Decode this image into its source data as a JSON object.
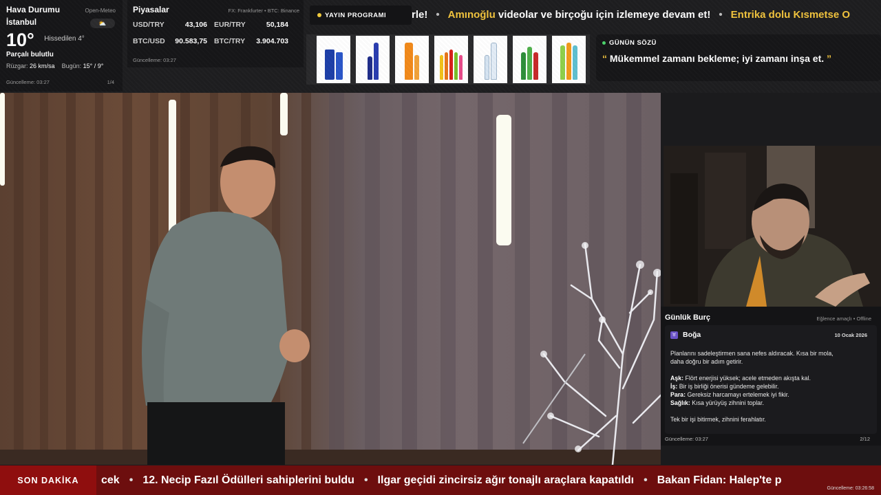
{
  "weather": {
    "title": "Hava Durumu",
    "source": "Open-Meteo",
    "city": "İstanbul",
    "temperature": "10°",
    "feels_like": "Hissedilen 4°",
    "condition": "Parçalı bulutlu",
    "wind_label": "Rüzgar:",
    "wind_value": "26 km/sa",
    "today_label": "Bugün:",
    "today_value": "15° / 9°",
    "updated": "Güncelleme: 03:27",
    "page": "1/4",
    "icon": "partly-cloudy-icon"
  },
  "markets": {
    "title": "Piyasalar",
    "source": "FX: Frankfurter • BTC: Binance",
    "rates": [
      {
        "pair": "USD/TRY",
        "value": "43,106"
      },
      {
        "pair": "EUR/TRY",
        "value": "50,184"
      },
      {
        "pair": "BTC/USD",
        "value": "90.583,75"
      },
      {
        "pair": "BTC/TRY",
        "value": "3.904.703"
      }
    ],
    "updated": "Güncelleme: 03:27"
  },
  "schedule": {
    "label": "YAYIN PROGRAMI"
  },
  "top_ticker": {
    "part1": "rle!",
    "part2_highlight": "Amınoğlu",
    "part2": " videolar ve birçoğu için izlemeye devam et!",
    "part3_highlight": "Entrika dolu Kısmetse O"
  },
  "quote": {
    "heading": "GÜNÜN SÖZÜ",
    "open_mark": "“",
    "text": "Mükemmel zamanı bekleme; iyi zamanı inşa et.",
    "close_mark": "”"
  },
  "horoscope": {
    "title": "Günlük Burç",
    "note": "Eğlence amaçlı • Offline",
    "sign": "Boğa",
    "date": "10 Ocak 2026",
    "summary_line1": "Planlarını sadeleştirmen sana nefes aldıracak. Kısa bir mola,",
    "summary_line2": "daha doğru bir adım getirir.",
    "love_label": "Aşk:",
    "love": " Flört enerjisi yüksek; acele etmeden akışta kal.",
    "work_label": "İş:",
    "work": " Bir iş birliği önerisi gündeme gelebilir.",
    "money_label": "Para:",
    "money": " Gereksiz harcamayı ertelemek iyi fikir.",
    "health_label": "Sağlık:",
    "health": " Kısa yürüyüş zihnini toplar.",
    "closing": "Tek bir işi bitirmek, zihnini ferahlatır.",
    "updated": "Güncelleme: 03:27",
    "page": "2/12"
  },
  "breaking": {
    "label": "SON DAKİKA",
    "items": [
      "cek",
      "12. Necip Fazıl Ödülleri sahiplerini buldu",
      "Ilgar geçidi zincirsiz ağır tonajlı araçlara kapatıldı",
      "Bakan Fidan: Halep'te p"
    ],
    "separator": "•",
    "updated": "Güncelleme: 03:26:58"
  },
  "colors": {
    "accent_yellow": "#f2c43d",
    "breaking_red": "#6d0e0e",
    "panel_dark": "#161618",
    "status_green": "#4bd36b"
  }
}
